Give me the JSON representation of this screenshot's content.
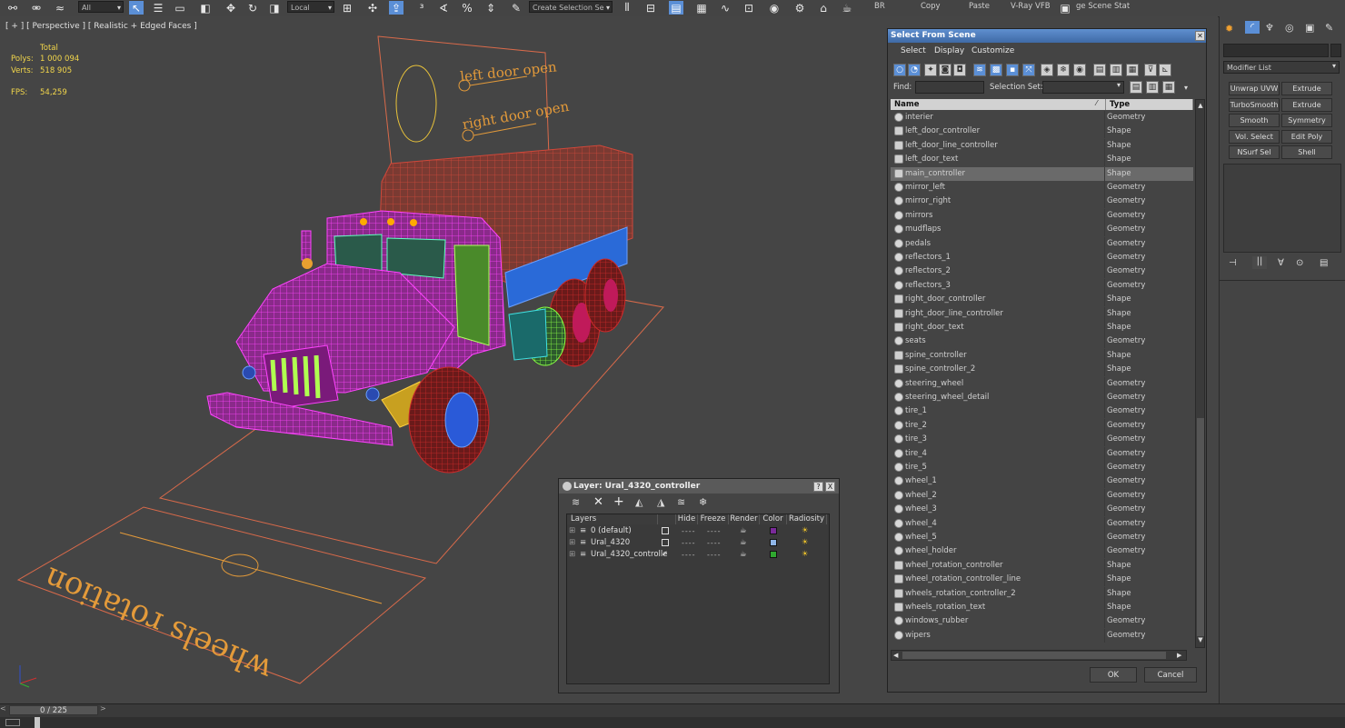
{
  "toolbar": {
    "filter_value": "All",
    "coord_value": "Local",
    "selection_set_placeholder": "Create Selection Se",
    "labels": [
      "BR",
      "Copy",
      "Paste",
      "V-Ray VFB",
      "ge Scene Stat"
    ]
  },
  "viewport": {
    "label": "[ + ] [ Perspective ] [ Realistic + Edged Faces ]",
    "stats": {
      "total_label": "Total",
      "polys_label": "Polys:",
      "polys_value": "1 000 094",
      "verts_label": "Verts:",
      "verts_value": "518 905",
      "fps_label": "FPS:",
      "fps_value": "54,259"
    },
    "board_text_1": "left door open",
    "board_text_2": "right door open",
    "floor_text": "wheels rotation"
  },
  "select_from_scene": {
    "title": "Select From Scene",
    "menu": [
      "Select",
      "Display",
      "Customize"
    ],
    "find_label": "Find:",
    "selection_set_label": "Selection Set:",
    "col_name": "Name",
    "col_type": "Type",
    "rows": [
      {
        "name": "interier",
        "type": "Geometry"
      },
      {
        "name": "left_door_controller",
        "type": "Shape"
      },
      {
        "name": "left_door_line_controller",
        "type": "Shape"
      },
      {
        "name": "left_door_text",
        "type": "Shape"
      },
      {
        "name": "main_controller",
        "type": "Shape",
        "selected": true
      },
      {
        "name": "mirror_left",
        "type": "Geometry"
      },
      {
        "name": "mirror_right",
        "type": "Geometry"
      },
      {
        "name": "mirrors",
        "type": "Geometry"
      },
      {
        "name": "mudflaps",
        "type": "Geometry"
      },
      {
        "name": "pedals",
        "type": "Geometry"
      },
      {
        "name": "reflectors_1",
        "type": "Geometry"
      },
      {
        "name": "reflectors_2",
        "type": "Geometry"
      },
      {
        "name": "reflectors_3",
        "type": "Geometry"
      },
      {
        "name": "right_door_controller",
        "type": "Shape"
      },
      {
        "name": "right_door_line_controller",
        "type": "Shape"
      },
      {
        "name": "right_door_text",
        "type": "Shape"
      },
      {
        "name": "seats",
        "type": "Geometry"
      },
      {
        "name": "spine_controller",
        "type": "Shape"
      },
      {
        "name": "spine_controller_2",
        "type": "Shape"
      },
      {
        "name": "steering_wheel",
        "type": "Geometry"
      },
      {
        "name": "steering_wheel_detail",
        "type": "Geometry"
      },
      {
        "name": "tire_1",
        "type": "Geometry"
      },
      {
        "name": "tire_2",
        "type": "Geometry"
      },
      {
        "name": "tire_3",
        "type": "Geometry"
      },
      {
        "name": "tire_4",
        "type": "Geometry"
      },
      {
        "name": "tire_5",
        "type": "Geometry"
      },
      {
        "name": "wheel_1",
        "type": "Geometry"
      },
      {
        "name": "wheel_2",
        "type": "Geometry"
      },
      {
        "name": "wheel_3",
        "type": "Geometry"
      },
      {
        "name": "wheel_4",
        "type": "Geometry"
      },
      {
        "name": "wheel_5",
        "type": "Geometry"
      },
      {
        "name": "wheel_holder",
        "type": "Geometry"
      },
      {
        "name": "wheel_rotation_controller",
        "type": "Shape"
      },
      {
        "name": "wheel_rotation_controller_line",
        "type": "Shape"
      },
      {
        "name": "wheels_rotation_controller_2",
        "type": "Shape"
      },
      {
        "name": "wheels_rotation_text",
        "type": "Shape"
      },
      {
        "name": "windows_rubber",
        "type": "Geometry"
      },
      {
        "name": "wipers",
        "type": "Geometry"
      }
    ],
    "ok_label": "OK",
    "cancel_label": "Cancel"
  },
  "layer_dialog": {
    "title": "Layer: Ural_4320_controller",
    "help_label": "?",
    "close_label": "X",
    "columns": [
      "Layers",
      "Hide",
      "Freeze",
      "Render",
      "Color",
      "Radiosity"
    ],
    "layers": [
      {
        "name": "0 (default)",
        "color": "#7a2a9a",
        "active": false
      },
      {
        "name": "Ural_4320",
        "color": "#8fb6e8",
        "active": false
      },
      {
        "name": "Ural_4320_controlle",
        "color": "#2fa82f",
        "active": true
      }
    ]
  },
  "command_panel": {
    "modifier_list": "Modifier List",
    "buttons": [
      "Unwrap UVW",
      "Extrude",
      "TurboSmooth",
      "Extrude",
      "Smooth",
      "Symmetry",
      "Vol. Select",
      "Edit Poly",
      "NSurf Sel",
      "Shell"
    ]
  },
  "timeline": {
    "frame_display": "0 / 225"
  }
}
